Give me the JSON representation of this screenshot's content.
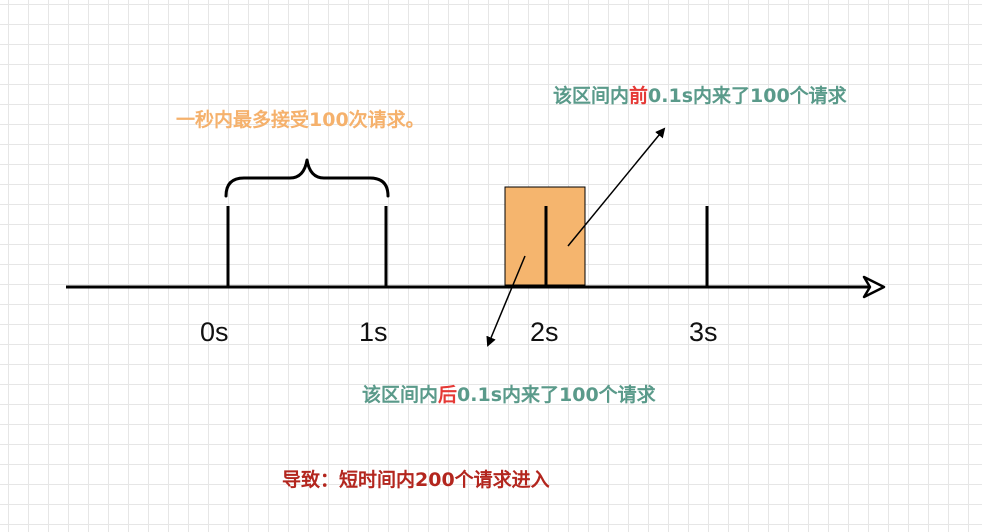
{
  "diagram": {
    "ticks": [
      "0s",
      "1s",
      "2s",
      "3s"
    ],
    "brace_label": "一秒内最多接受100次请求。",
    "top_note": {
      "pre": "该区间内",
      "highlight": "前",
      "post": "0.1s内来了100个请求"
    },
    "bottom_note": {
      "pre": "该区间内",
      "highlight": "后",
      "post": "0.1s内来了100个请求"
    },
    "conclusion": "导致：短时间内200个请求进入",
    "colors": {
      "highlight_box": "#f5b56e",
      "brace_label": "#f5b16c",
      "note_text": "#5a9a8a",
      "note_highlight": "#e53935",
      "conclusion": "#b3261e",
      "axis": "#000000"
    }
  }
}
